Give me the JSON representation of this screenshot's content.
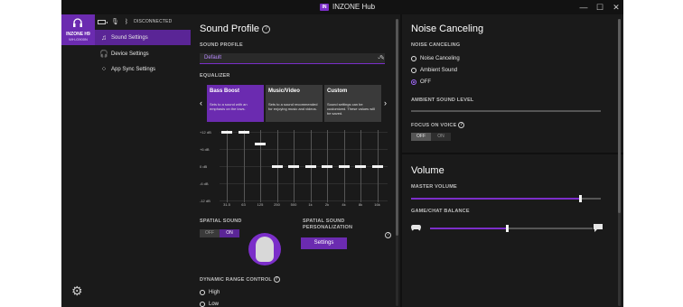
{
  "app": {
    "logo_text": "IN",
    "title": "INZONE Hub",
    "window_controls": [
      "—",
      "☐",
      "✕"
    ]
  },
  "device": {
    "name": "INZONE H9",
    "model": "WH-G900N",
    "status": "DISCONNECTED"
  },
  "sidebar": {
    "items": [
      {
        "label": "Sound Settings",
        "icon": "music-note-icon",
        "active": true
      },
      {
        "label": "Device Settings",
        "icon": "headphones-icon",
        "active": false
      },
      {
        "label": "App Sync Settings",
        "icon": "apps-grid-icon",
        "active": false
      }
    ]
  },
  "sound_profile": {
    "title": "Sound Profile",
    "label": "SOUND PROFILE",
    "selected": "Default"
  },
  "equalizer": {
    "label": "EQUALIZER",
    "presets": [
      {
        "title": "Bass Boost",
        "desc": "Sets to a sound with an emphasis on the lows.",
        "active": true
      },
      {
        "title": "Music/Video",
        "desc": "Sets to a sound recommended for enjoying music and videos.",
        "active": false
      },
      {
        "title": "Custom",
        "desc": "Sound settings can be customized. These values will be saved.",
        "active": false
      }
    ],
    "y_labels": [
      "+12 dB",
      "+6 dB",
      "0 dB",
      "-6 dB",
      "-12 dB"
    ],
    "bands": [
      "31.5",
      "63",
      "125",
      "250",
      "500",
      "1k",
      "2k",
      "4k",
      "8k",
      "16k"
    ],
    "values": [
      12,
      12,
      8,
      0,
      0,
      0,
      0,
      0,
      0,
      0
    ],
    "range": [
      -12,
      12
    ]
  },
  "spatial_sound": {
    "label": "SPATIAL SOUND",
    "off": "OFF",
    "on": "ON",
    "state": "ON",
    "personalization_label_1": "SPATIAL SOUND",
    "personalization_label_2": "PERSONALIZATION",
    "settings_button": "Settings"
  },
  "dynamic_range": {
    "label": "DYNAMIC RANGE CONTROL",
    "options": [
      "High",
      "Low"
    ]
  },
  "noise_canceling": {
    "title": "Noise Canceling",
    "label": "NOISE CANCELING",
    "options": [
      "Noise Canceling",
      "Ambient Sound",
      "OFF"
    ],
    "selected": "OFF",
    "ambient_label": "AMBIENT SOUND LEVEL",
    "ambient_level": 0,
    "focus_label": "FOCUS ON VOICE",
    "focus_off": "OFF",
    "focus_on": "ON",
    "focus_state": "OFF"
  },
  "volume": {
    "title": "Volume",
    "master_label": "MASTER VOLUME",
    "master_level": 0.89,
    "balance_label": "GAME/CHAT BALANCE",
    "balance_level": 0.47
  }
}
